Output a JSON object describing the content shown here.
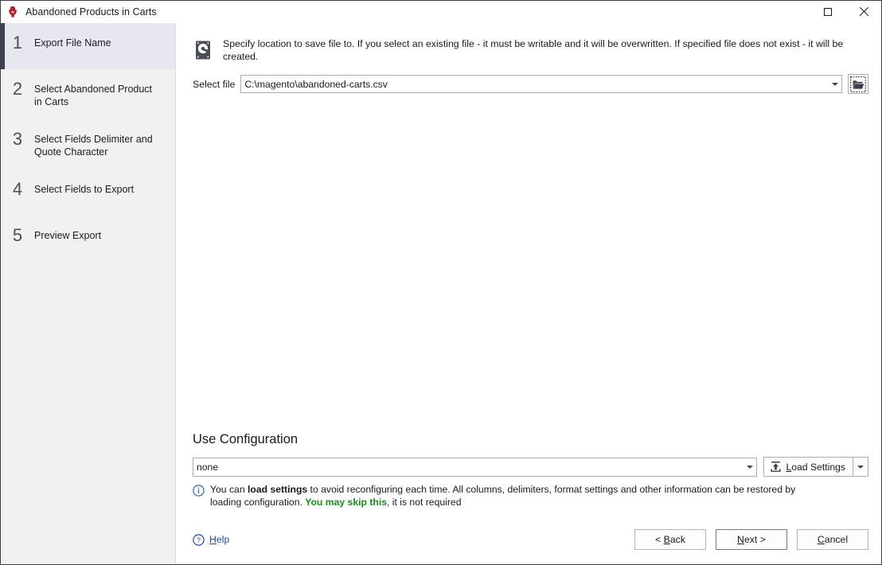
{
  "window": {
    "title": "Abandoned Products in Carts",
    "app_icon": "sprocket-icon",
    "controls": {
      "maximize": "maximize-icon",
      "close": "close-icon"
    }
  },
  "sidebar": {
    "steps": [
      {
        "number": "1",
        "label": "Export File Name",
        "selected": true
      },
      {
        "number": "2",
        "label": "Select Abandoned Product in Carts",
        "selected": false
      },
      {
        "number": "3",
        "label": "Select Fields Delimiter and Quote Character",
        "selected": false
      },
      {
        "number": "4",
        "label": "Select Fields to Export",
        "selected": false
      },
      {
        "number": "5",
        "label": "Preview Export",
        "selected": false
      }
    ]
  },
  "main": {
    "instruction_icon": "hard-drive-icon",
    "instruction": "Specify location to save file to. If you select an existing file - it must be writable and it will be overwritten. If specified file does not exist - it will be created.",
    "select_file": {
      "label": "Select file",
      "value": "C:\\magento\\abandoned-carts.csv",
      "placeholder": "",
      "dropdown_icon": "chevron-down-icon",
      "browse_icon": "folder-open-icon"
    },
    "configuration": {
      "heading": "Use Configuration",
      "value": "none",
      "placeholder": "",
      "dropdown_icon": "chevron-down-icon",
      "load_settings_label_pre": "L",
      "load_settings_label_post": "oad Settings",
      "load_settings_icon": "upload-icon",
      "split_icon": "chevron-down-icon"
    },
    "info": {
      "icon": "info-icon",
      "part1": "You can ",
      "bold1": "load settings",
      "part2": " to avoid reconfiguring each time. All columns, delimiters, format settings and other information can be restored by loading configuration. ",
      "green": "You may skip this",
      "part3": ", it is not required"
    }
  },
  "footer": {
    "help_icon": "help-circle-icon",
    "help_label_pre": "H",
    "help_label_post": "elp",
    "back_label_pre": "< ",
    "back_label_mnem": "B",
    "back_label_post": "ack",
    "next_label_pre": "N",
    "next_label_mnem": "",
    "next_label_post": "ext >",
    "cancel_label_pre": "C",
    "cancel_label_post": "ancel"
  },
  "colors": {
    "sidebar_bg": "#f1f1f1",
    "sidebar_selected_bg": "#e7e7ef",
    "sidebar_selected_bar": "#3f4150",
    "accent_green": "#169016",
    "link_blue": "#1d4fa0",
    "window_border": "#3b3f4a"
  }
}
